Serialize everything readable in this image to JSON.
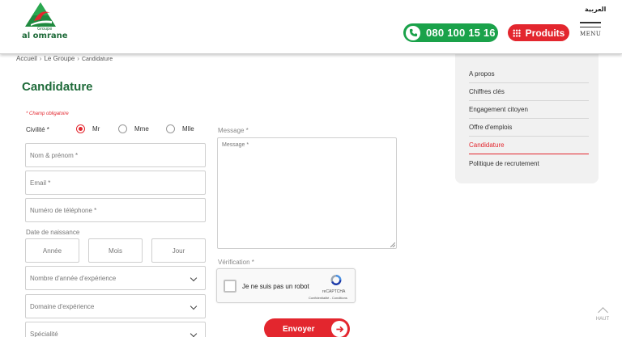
{
  "header": {
    "logo_top": "Groupe",
    "logo_name": "al omrane",
    "lang_link": "العربية",
    "phone": "080 100 15 16",
    "produits_label": "Produits",
    "menu_label": "MENU"
  },
  "breadcrumb": [
    "Accueil",
    "Le Groupe",
    "Candidature"
  ],
  "page_title": "Candidature",
  "form": {
    "required_note": "* Champ obligatoire",
    "civilite_label": "Civilité *",
    "civilite_options": [
      "Mr",
      "Mme",
      "Mlle"
    ],
    "civilite_selected": "Mr",
    "name_placeholder": "Nom & prénom *",
    "email_placeholder": "Email *",
    "phone_placeholder": "Numéro de téléphone *",
    "dob_label": "Date de naissance",
    "dob": {
      "year": "Année",
      "month": "Mois",
      "day": "Jour"
    },
    "experience_years": "Nombre d'année d'expérience",
    "experience_domain": "Domaine d'expérience",
    "speciality": "Spécialité",
    "message_label": "Message *",
    "message_placeholder": "Message *",
    "verification_label": "Vérification *",
    "submit_label": "Envoyer"
  },
  "captcha": {
    "text": "Je ne suis pas un robot",
    "brand": "reCAPTCHA",
    "links": "Confidentialité - Conditions"
  },
  "side_menu": {
    "items": [
      "A propos",
      "Chiffres clés",
      "Engagement citoyen",
      "Offre d'emplois",
      "Candidature",
      "Politique de recrutement"
    ],
    "active": "Candidature"
  },
  "back_to_top": "HAUT",
  "colors": {
    "brand_green": "#1f6b3a",
    "brand_red": "#e3262e",
    "phone_green": "#1aa24a"
  }
}
